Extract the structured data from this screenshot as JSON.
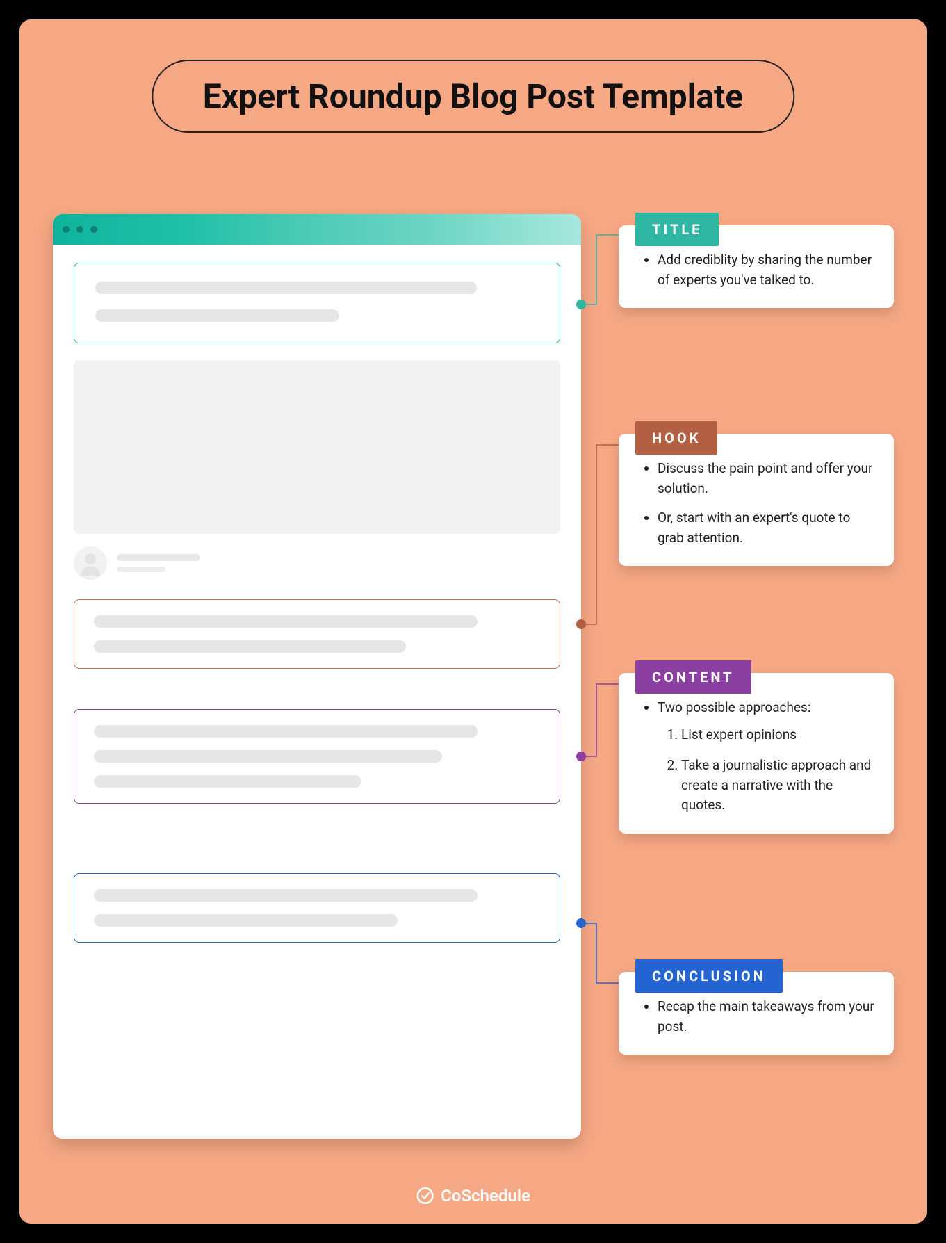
{
  "header": {
    "title": "Expert Roundup Blog Post Template"
  },
  "cards": {
    "title": {
      "label": "TITLE",
      "bullet1": "Add crediblity by sharing the number of experts you've talked to."
    },
    "hook": {
      "label": "HOOK",
      "bullet1": "Discuss the pain point and offer your solution.",
      "bullet2": "Or, start with an expert's quote to grab attention."
    },
    "content": {
      "label": "CONTENT",
      "intro": "Two possible approaches:",
      "item1": "List expert opinions",
      "item2": "Take a journalistic approach and create a narrative with the quotes."
    },
    "conclusion": {
      "label": "CONCLUSION",
      "bullet1": "Recap the main takeaways from your post."
    }
  },
  "colors": {
    "title": "#2fb7a3",
    "hook": "#b35f44",
    "content": "#8b3fa1",
    "conclusion": "#2363d2"
  },
  "footer": {
    "brand": "CoSchedule"
  }
}
